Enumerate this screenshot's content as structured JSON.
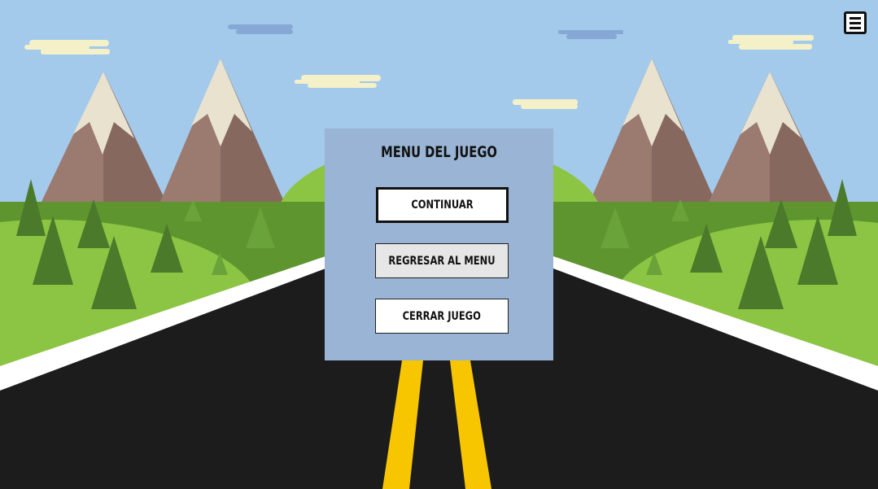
{
  "game": {
    "scene": "mountain-road"
  },
  "menu": {
    "title": "MENU DEL JUEGO",
    "buttons": {
      "continue": "CONTINUAR",
      "back_to_menu": "REGRESAR AL MENU",
      "close_game": "CERRAR JUEGO"
    }
  },
  "toolbar": {
    "menu_icon": "hamburger-menu-icon"
  },
  "colors": {
    "sky": "#a3c9eb",
    "road": "#1c1c1c",
    "road_line": "#f7c600",
    "grass_light": "#8cc443",
    "grass_dark": "#5a8f2e",
    "mountain": "#9b7a70",
    "snow": "#e8e2cf",
    "panel": "#99b4d4"
  }
}
